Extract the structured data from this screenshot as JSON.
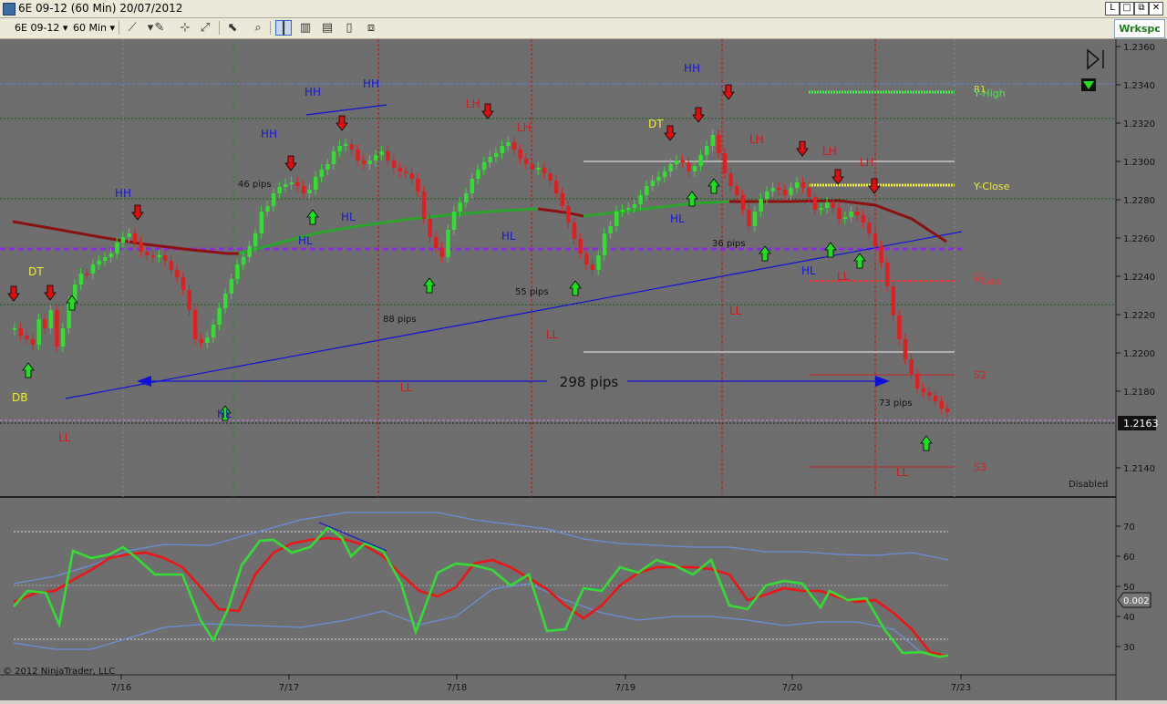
{
  "window": {
    "title": "6E 09-12 (60 Min)  20/07/2012",
    "buttons": [
      "L",
      "□",
      "⧉",
      "✕"
    ]
  },
  "toolbar": {
    "instrument": "6E 09-12",
    "interval": "60 Min",
    "workspace": "Wrkspc",
    "icons": [
      "draw-line-icon",
      "pencil-icon",
      "crosshair-icon",
      "zoom-icon",
      "select-icon",
      "magnifier-icon",
      "bar-style-icon",
      "candlestick-icon",
      "chart-properties-icon",
      "data-box-icon",
      "strategy-icon"
    ]
  },
  "colors": {
    "background": "#6e6e6e",
    "up_candle": "#33dd33",
    "down_candle": "#e02020",
    "ma_up": "#2aa62a",
    "ma_down": "#8b1010",
    "trendline": "#1010dd",
    "pivot_line": "#8a2be2"
  },
  "price_axis": {
    "ticks": [
      "1.2360",
      "1.2340",
      "1.2320",
      "1.2300",
      "1.2280",
      "1.2260",
      "1.2240",
      "1.2220",
      "1.2200",
      "1.2180",
      "1.2140"
    ],
    "current_price": "1.2163",
    "status": "Disabled"
  },
  "pivot_labels": {
    "high": "Y-High",
    "r1": "R1",
    "close": "Y-Close",
    "s1": "S1",
    "low": "Y-Low",
    "s2": "S2",
    "s3": "S3"
  },
  "annotations": {
    "range_label": "298 pips",
    "swing_labels": [
      {
        "text": "HH",
        "color": "blue"
      },
      {
        "text": "HH",
        "color": "blue"
      },
      {
        "text": "HH",
        "color": "blue"
      },
      {
        "text": "HH",
        "color": "blue"
      },
      {
        "text": "HH",
        "color": "blue"
      },
      {
        "text": "HL",
        "color": "blue"
      },
      {
        "text": "HL",
        "color": "blue"
      },
      {
        "text": "HL",
        "color": "blue"
      },
      {
        "text": "HL",
        "color": "blue"
      },
      {
        "text": "HL",
        "color": "blue"
      },
      {
        "text": "HL",
        "color": "blue"
      },
      {
        "text": "LH",
        "color": "red"
      },
      {
        "text": "LH",
        "color": "red"
      },
      {
        "text": "LH",
        "color": "red"
      },
      {
        "text": "LH",
        "color": "red"
      },
      {
        "text": "LH",
        "color": "red"
      },
      {
        "text": "LL",
        "color": "red"
      },
      {
        "text": "LL",
        "color": "red"
      },
      {
        "text": "LL",
        "color": "red"
      },
      {
        "text": "LL",
        "color": "red"
      },
      {
        "text": "LL",
        "color": "red"
      },
      {
        "text": "LL",
        "color": "red"
      },
      {
        "text": "DT",
        "color": "yellow"
      },
      {
        "text": "DT",
        "color": "yellow"
      },
      {
        "text": "DB",
        "color": "yellow"
      }
    ],
    "pip_labels": [
      "46 pips",
      "88 pips",
      "55 pips",
      "36 pips",
      "73 pips"
    ]
  },
  "oscillator_axis": {
    "ticks": [
      "70",
      "60",
      "50",
      "40",
      "30"
    ],
    "current_value": "0.002"
  },
  "date_axis": {
    "ticks": [
      "7/16",
      "7/17",
      "7/18",
      "7/19",
      "7/20",
      "7/23"
    ]
  },
  "copyright": "© 2012 NinjaTrader, LLC"
}
